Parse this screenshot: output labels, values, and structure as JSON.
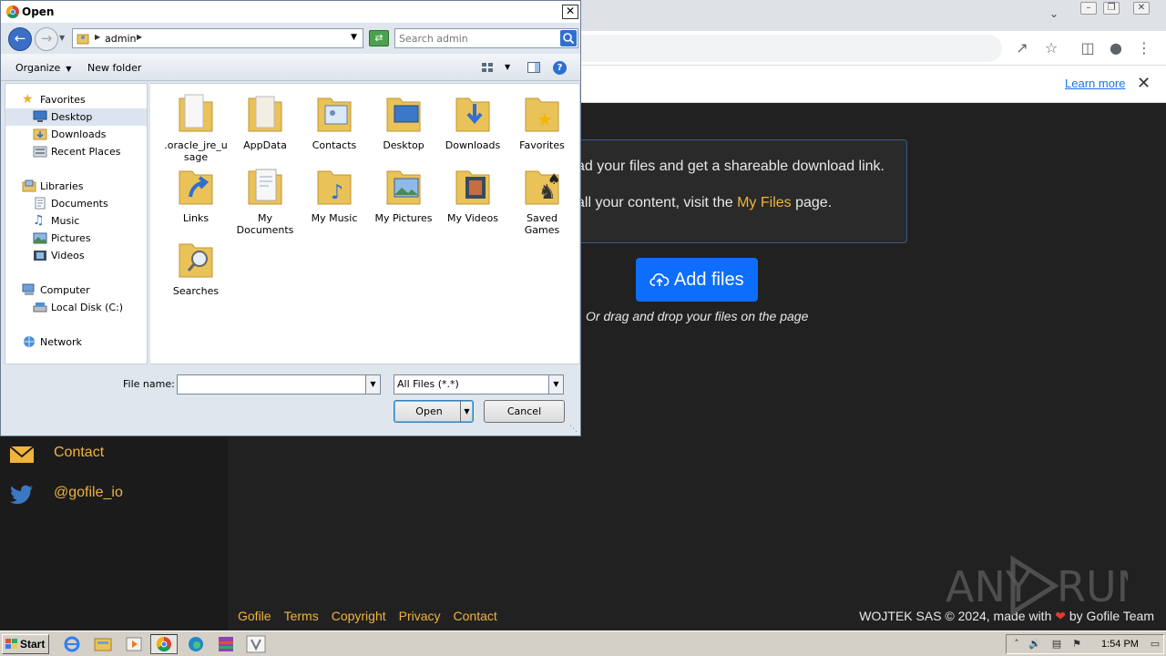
{
  "browser": {
    "learn_more": "Learn more"
  },
  "page": {
    "info_line1": "ad your files and get a shareable download link.",
    "info_line2_prefix": "all your content, visit the ",
    "info_line2_link": "My Files",
    "info_line2_suffix": " page.",
    "add_files_label": "Add files",
    "drag_hint": "Or drag and drop your files on the page",
    "sidebar": {
      "contact": "Contact",
      "twitter": "@gofile_io"
    },
    "footer_links": [
      "Gofile",
      "Terms",
      "Copyright",
      "Privacy",
      "Contact"
    ],
    "footer_right_prefix": "WOJTEK SAS © 2024, made with ",
    "footer_right_suffix": " by Gofile Team",
    "watermark": "ANY RUN"
  },
  "dialog": {
    "title": "Open",
    "breadcrumb": "admin",
    "search_placeholder": "Search admin",
    "organize": "Organize",
    "new_folder": "New folder",
    "nav_items": [
      {
        "label": "Favorites",
        "icon": "star-icon"
      },
      {
        "label": "Desktop",
        "icon": "desktop-icon",
        "selected": true
      },
      {
        "label": "Downloads",
        "icon": "downloads-folder-icon"
      },
      {
        "label": "Recent Places",
        "icon": "recent-places-icon"
      },
      {
        "label": "Libraries",
        "icon": "libraries-icon"
      },
      {
        "label": "Documents",
        "icon": "documents-icon"
      },
      {
        "label": "Music",
        "icon": "music-icon"
      },
      {
        "label": "Pictures",
        "icon": "pictures-icon"
      },
      {
        "label": "Videos",
        "icon": "videos-icon"
      },
      {
        "label": "Computer",
        "icon": "computer-icon"
      },
      {
        "label": "Local Disk (C:)",
        "icon": "disk-icon"
      },
      {
        "label": "Network",
        "icon": "network-icon"
      }
    ],
    "files": [
      {
        "name": ".oracle_jre_usage",
        "icon": "folder-icon"
      },
      {
        "name": "AppData",
        "icon": "folder-icon"
      },
      {
        "name": "Contacts",
        "icon": "contacts-folder-icon"
      },
      {
        "name": "Desktop",
        "icon": "desktop-folder-icon"
      },
      {
        "name": "Downloads",
        "icon": "downloads-folder-icon"
      },
      {
        "name": "Favorites",
        "icon": "favorites-folder-icon"
      },
      {
        "name": "Links",
        "icon": "links-folder-icon"
      },
      {
        "name": "My Documents",
        "icon": "documents-folder-icon"
      },
      {
        "name": "My Music",
        "icon": "music-folder-icon"
      },
      {
        "name": "My Pictures",
        "icon": "pictures-folder-icon"
      },
      {
        "name": "My Videos",
        "icon": "videos-folder-icon"
      },
      {
        "name": "Saved Games",
        "icon": "saved-games-folder-icon"
      },
      {
        "name": "Searches",
        "icon": "searches-folder-icon"
      }
    ],
    "file_name_label": "File name:",
    "file_name_value": "",
    "file_type": "All Files (*.*)",
    "open_label": "Open",
    "cancel_label": "Cancel"
  },
  "taskbar": {
    "start_label": "Start",
    "clock": "1:54 PM"
  },
  "colors": {
    "accent_gold": "#f0b43b",
    "button_blue": "#0d6efd",
    "page_bg": "#212121",
    "dialog_bg": "#dfe6ee"
  }
}
